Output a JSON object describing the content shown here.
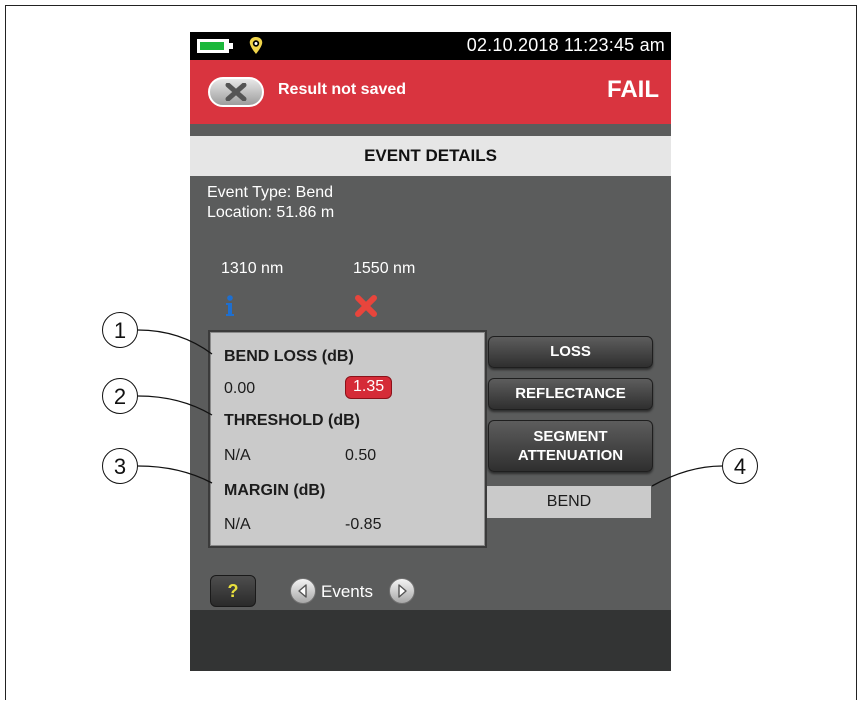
{
  "status_bar": {
    "datetime": "02.10.2018 11:23:45 am"
  },
  "header": {
    "save_status": "Result not saved",
    "result": "FAIL"
  },
  "title": "EVENT DETAILS",
  "event": {
    "type": "Event Type: Bend",
    "location": "Location: 51.86 m"
  },
  "wavelengths": [
    "1310 nm",
    "1550 nm"
  ],
  "wavelength_status_icons": [
    "info-icon",
    "fail-icon"
  ],
  "details": {
    "bend_loss_label": "BEND LOSS (dB)",
    "bend_loss_values": [
      "0.00",
      "1.35"
    ],
    "threshold_label": "THRESHOLD (dB)",
    "threshold_values": [
      "N/A",
      "0.50"
    ],
    "margin_label": "MARGIN (dB)",
    "margin_values": [
      "N/A",
      "-0.85"
    ]
  },
  "buttons": {
    "loss": "LOSS",
    "reflectance": "REFLECTANCE",
    "segment_line1": "SEGMENT",
    "segment_line2": "ATTENUATION",
    "bend": "BEND"
  },
  "nav": {
    "help": "?",
    "events": "Events"
  },
  "callouts": [
    "1",
    "2",
    "3",
    "4"
  ],
  "colors": {
    "header_red": "#d9343f",
    "fail_badge": "#d52b37",
    "battery_green": "#1bb83b",
    "info_blue": "#1e6fd0"
  }
}
